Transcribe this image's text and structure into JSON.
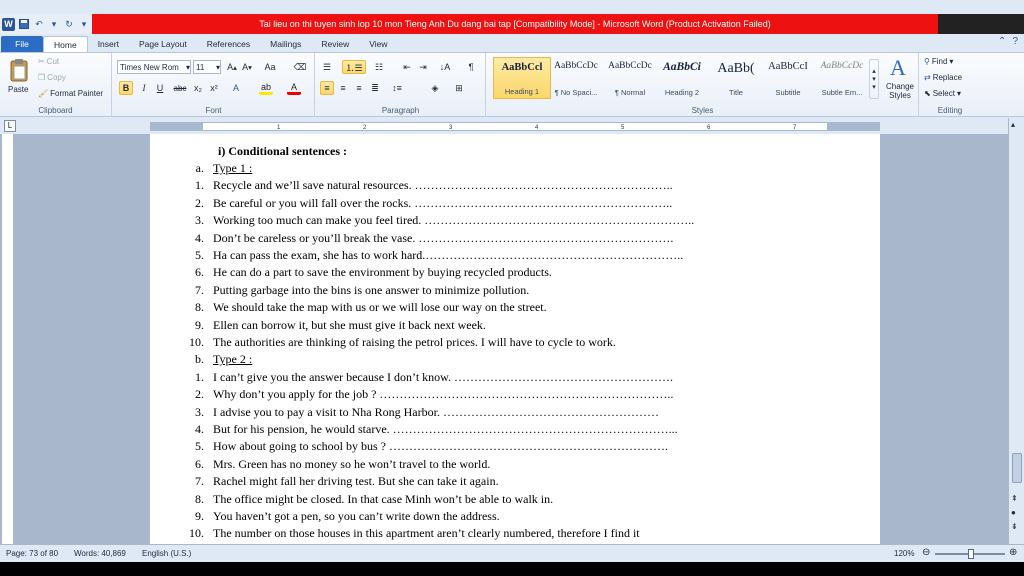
{
  "window": {
    "title": "Tai lieu on thi tuyen sinh lop 10 mon Tieng Anh Du dang bai tap [Compatibility Mode]  -  Microsoft Word (Product Activation Failed)"
  },
  "tabs": [
    "File",
    "Home",
    "Insert",
    "Page Layout",
    "References",
    "Mailings",
    "Review",
    "View"
  ],
  "ribbon": {
    "clipboard": {
      "label": "Clipboard",
      "paste": "Paste",
      "cut": "Cut",
      "copy": "Copy",
      "format_painter": "Format Painter"
    },
    "font": {
      "label": "Font",
      "family": "Times New Rom",
      "size": "11"
    },
    "paragraph": {
      "label": "Paragraph"
    },
    "styles": {
      "label": "Styles",
      "items": [
        {
          "sample": "AaBbCcl",
          "name": "Heading 1"
        },
        {
          "sample": "AaBbCcDc",
          "name": "¶ No Spaci..."
        },
        {
          "sample": "AaBbCcDc",
          "name": "¶ Normal"
        },
        {
          "sample": "AaBbCi",
          "name": "Heading 2"
        },
        {
          "sample": "AaBb(",
          "name": "Title"
        },
        {
          "sample": "AaBbCcI",
          "name": "Subtitle"
        },
        {
          "sample": "AaBbCcDc",
          "name": "Subtle Em..."
        }
      ],
      "change_styles": "Change Styles"
    },
    "editing": {
      "label": "Editing",
      "find": "Find",
      "replace": "Replace",
      "select": "Select"
    }
  },
  "ruler": {
    "ticks": [
      "1",
      "2",
      "3",
      "4",
      "5",
      "6",
      "7"
    ]
  },
  "document": {
    "heading": "i)   Conditional sentences :",
    "lines": [
      {
        "num": "a.",
        "text": "Type 1 :"
      },
      {
        "num": "1.",
        "text": "Recycle and we’ll save natural resources. ……………………………………………………….."
      },
      {
        "num": "2.",
        "text": "Be careful or you will fall over the rocks. ……………………………………………………….."
      },
      {
        "num": "3.",
        "text": "Working too much can make you feel tired. ………………………………………………………….."
      },
      {
        "num": "4.",
        "text": "Don’t be careless or you’ll break the vase. ………………………………………………………."
      },
      {
        "num": "5.",
        "text": "Ha can pass the exam, she has to work hard.……………………………………………………….."
      },
      {
        "num": "6.",
        "text": "He can do a part to save the environment by buying recycled products."
      },
      {
        "num": "7.",
        "text": "Putting garbage into the bins is one answer to minimize pollution."
      },
      {
        "num": "8.",
        "text": "We should take the map with us or we will lose our way on the street."
      },
      {
        "num": "9.",
        "text": "Ellen can borrow it, but she must give it back next week."
      },
      {
        "num": "10.",
        "text": "The authorities are thinking of raising the petrol prices. I will have to cycle to work."
      },
      {
        "num": "b.",
        "text": "Type 2 :"
      },
      {
        "num": "1.",
        "text": "I can’t give you the answer because I don’t know. ………………………………………………."
      },
      {
        "num": "2.",
        "text": "Why don’t you apply for the job ? ……………………………………………………………….."
      },
      {
        "num": "3.",
        "text": "I advise you to pay a visit to Nha Rong Harbor. ………………………………………………"
      },
      {
        "num": "4.",
        "text": "But for his pension, he would starve. ……………………………………………………………..."
      },
      {
        "num": "5.",
        "text": "How about going to school by bus ? ……………………………………………………………."
      },
      {
        "num": "6.",
        "text": "Mrs. Green has no money so he won’t travel to the world."
      },
      {
        "num": "7.",
        "text": "Rachel might fall her driving test. But she can take it again."
      },
      {
        "num": "8.",
        "text": "The office might be closed. In that case Minh won’t be able to walk in."
      },
      {
        "num": "9.",
        "text": "You haven’t got a pen, so you can’t write down the address."
      },
      {
        "num": "10.",
        "text": "The number on those houses in this apartment aren’t clearly numbered, therefore I find it"
      }
    ]
  },
  "status": {
    "page": "Page: 73 of 80",
    "words": "Words: 40,869",
    "language": "English (U.S.)",
    "zoom": "120%"
  }
}
